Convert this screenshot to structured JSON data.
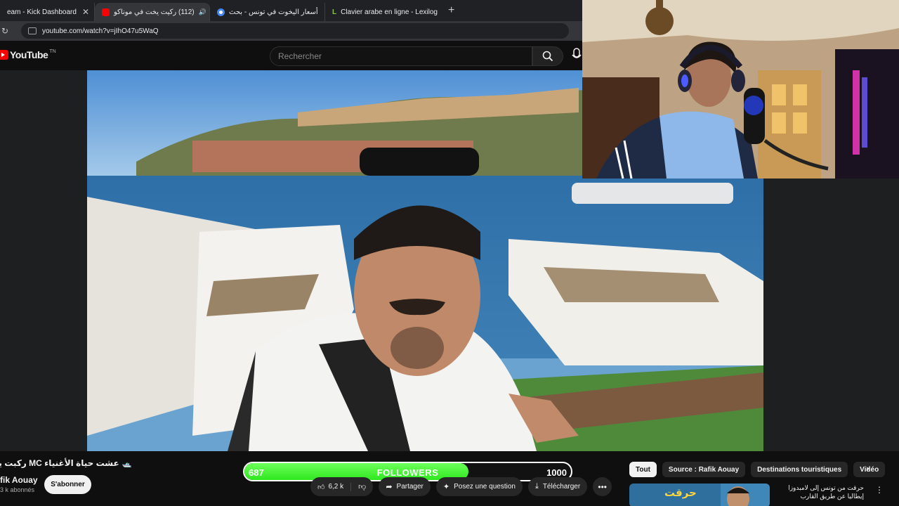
{
  "browser": {
    "tabs": [
      {
        "title": "eam - Kick Dashboard",
        "favicon_color": "#53fc18"
      },
      {
        "title": "(112) رکیت یخت في موناكو",
        "favicon_color": "#ff0000",
        "audio": "🔊"
      },
      {
        "title": "أسعار اليخوت في تونس - بحث",
        "favicon_color": "#4285f4"
      },
      {
        "title": "Clavier arabe en ligne - Lexilog",
        "favicon_color": "#8bc34a",
        "favicon_letter": "L"
      }
    ],
    "close_glyph": "✕",
    "new_tab_glyph": "+",
    "url": "youtube.com/watch?v=jIhO47u5WaQ"
  },
  "youtube": {
    "logo_text": "YouTube",
    "logo_suffix": "TN",
    "search_placeholder": "Rechercher"
  },
  "video": {
    "title": "🛥️ عشت حياة الأغنياء MC ركبت يخت في",
    "channel": "fik Aouay",
    "subscribers": "3 k abonnés",
    "subscribe_label": "S'abonner",
    "likes": "6,2 k",
    "actions": [
      {
        "icon": "share-icon",
        "glyph": "➦",
        "label": "Partager"
      },
      {
        "icon": "sparkle-icon",
        "glyph": "✦",
        "label": "Posez une question"
      },
      {
        "icon": "download-icon",
        "glyph": "⤓",
        "label": "Télécharger"
      }
    ],
    "more_glyph": "•••"
  },
  "followers_widget": {
    "current": "687",
    "label": "FOLLOWERS",
    "goal": "1000",
    "progress": 0.687,
    "fill_color": "#3ff02c"
  },
  "recommendations": {
    "chips": [
      "Tout",
      "Source : Rafik Aouay",
      "Destinations touristiques",
      "Vidéo"
    ],
    "next_glyph": "›",
    "first": {
      "thumb_text": "حرقت",
      "title": "حرقت من تونس إلى لامبدوزا إيطاليا عن طريق القارب",
      "menu_glyph": "⋮"
    }
  },
  "colors": {
    "accent_red": "#ff0000",
    "progress_green": "#3ff02c"
  }
}
